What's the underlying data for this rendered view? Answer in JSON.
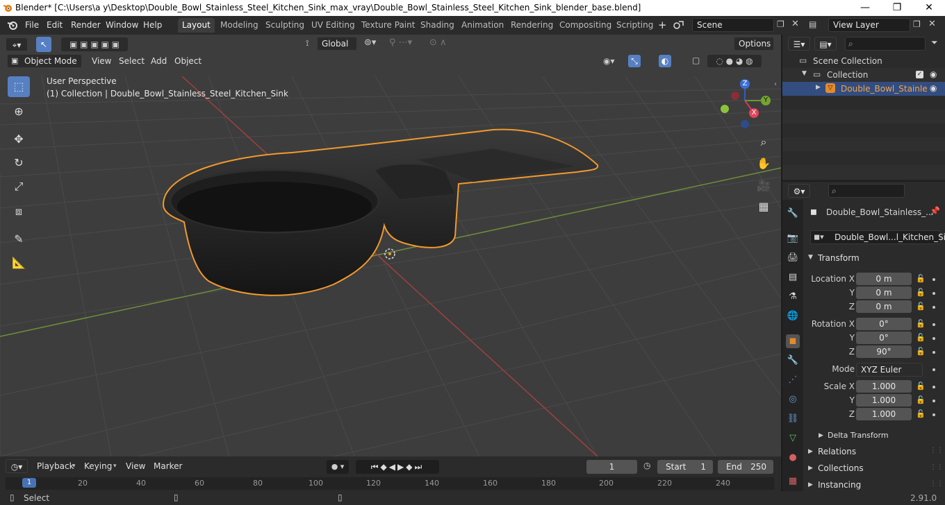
{
  "window": {
    "title": "Blender* [C:\\Users\\a y\\Desktop\\Double_Bowl_Stainless_Steel_Kitchen_Sink_max_vray\\Double_Bowl_Stainless_Steel_Kitchen_Sink_blender_base.blend]",
    "minimize": "—",
    "maximize": "❐",
    "close": "✕"
  },
  "menu": [
    "File",
    "Edit",
    "Render",
    "Window",
    "Help"
  ],
  "workspaces": [
    "Layout",
    "Modeling",
    "Sculpting",
    "UV Editing",
    "Texture Paint",
    "Shading",
    "Animation",
    "Rendering",
    "Compositing",
    "Scripting"
  ],
  "workspace_add": "+",
  "scene": {
    "label": "Scene"
  },
  "view_layer": {
    "label": "View Layer"
  },
  "header": {
    "orientation": "Global",
    "options": "Options"
  },
  "viewport_header": {
    "mode": "Object Mode",
    "menus": [
      "View",
      "Select",
      "Add",
      "Object"
    ]
  },
  "viewport": {
    "perspective": "User Perspective",
    "collection_info": "(1) Collection | Double_Bowl_Stainless_Steel_Kitchen_Sink",
    "gizmo": {
      "z": "Z",
      "y": "Y",
      "x": "X"
    }
  },
  "timeline": {
    "menus": [
      "Playback",
      "Keying",
      "View",
      "Marker"
    ],
    "current_frame": "1",
    "start_label": "Start",
    "start": "1",
    "end_label": "End",
    "end": "250",
    "ruler": [
      "1",
      "20",
      "40",
      "60",
      "80",
      "100",
      "120",
      "140",
      "160",
      "180",
      "200",
      "220",
      "240"
    ]
  },
  "outliner": {
    "scene_collection": "Scene Collection",
    "collection": "Collection",
    "object": "Double_Bowl_Stainle"
  },
  "properties": {
    "object_name": "Double_Bowl_Stainless_...",
    "data_name": "Double_Bowl...l_Kitchen_Sink",
    "transform_title": "Transform",
    "location": {
      "label": "Location X",
      "x": "0 m",
      "y": "0 m",
      "z": "0 m"
    },
    "rotation": {
      "label": "Rotation X",
      "x": "0°",
      "y": "0°",
      "z": "90°"
    },
    "mode": {
      "label": "Mode",
      "value": "XYZ Euler"
    },
    "scale": {
      "label": "Scale X",
      "x": "1.000",
      "y": "1.000",
      "z": "1.000"
    },
    "axis_y": "Y",
    "axis_z": "Z",
    "delta_transform": "Delta Transform",
    "relations": "Relations",
    "collections": "Collections",
    "instancing": "Instancing"
  },
  "status": {
    "select": "Select",
    "version": "2.91.0"
  },
  "colors": {
    "accent": "#5680c2",
    "selection": "#f29a2e",
    "viewport_bg": "#3d3d3d",
    "panel_bg": "#2b2b2b"
  }
}
